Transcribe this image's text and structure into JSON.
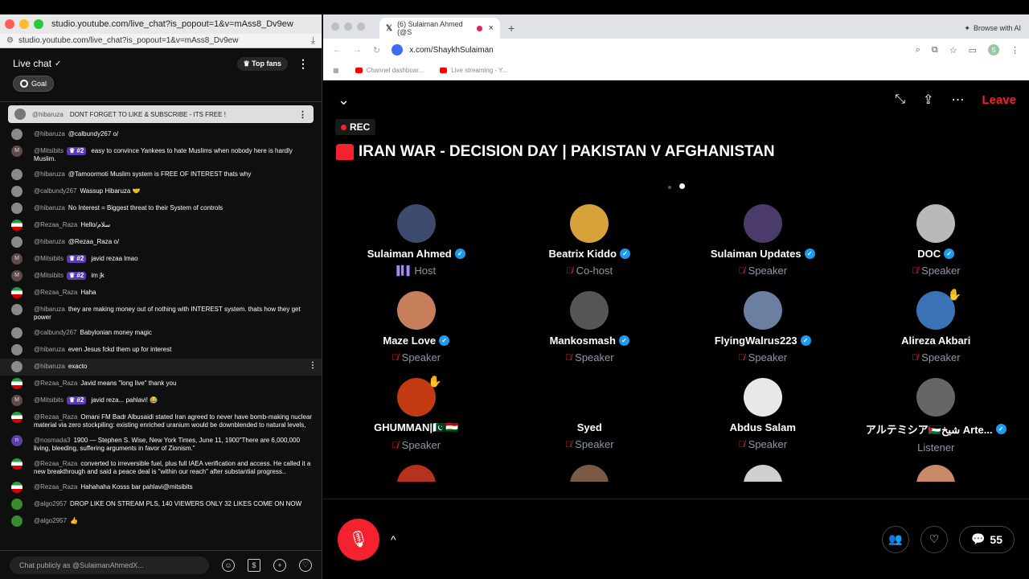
{
  "left_window": {
    "title": "studio.youtube.com/live_chat?is_popout=1&v=mAss8_Dv9ew",
    "url": "studio.youtube.com/live_chat?is_popout=1&v=mAss8_Dv9ew",
    "chat_title": "Live chat",
    "top_fans_label": "Top fans",
    "goal_label": "Goal",
    "pinned": {
      "author": "@hibaruza",
      "text": "DONT FORGET TO LIKE & SUBSCRIBE - ITS FREE !"
    },
    "messages": [
      {
        "author": "@hibaruza",
        "text": "@calbundy267 o/",
        "avatar": "gray",
        "initial": "",
        "badge": ""
      },
      {
        "author": "@Mitsibits",
        "text": "easy to convince Yankees to hate Muslims when nobody here is hardly Muslim.",
        "avatar": "m",
        "initial": "M",
        "badge": "#2"
      },
      {
        "author": "@hibaruza",
        "text": "@Tamoormoti Muslim system is FREE OF INTEREST thats why",
        "avatar": "gray",
        "initial": "",
        "badge": ""
      },
      {
        "author": "@calbundy267",
        "text": "Wassup Hibaruza 🤝",
        "avatar": "gray",
        "initial": "",
        "badge": ""
      },
      {
        "author": "@hibaruza",
        "text": "No Interest = Biggest threat to their System of controls",
        "avatar": "gray",
        "initial": "",
        "badge": ""
      },
      {
        "author": "@Rezaa_Raza",
        "text": "Hello/سلام",
        "avatar": "flag",
        "initial": "",
        "badge": ""
      },
      {
        "author": "@hibaruza",
        "text": "@Rezaa_Raza o/",
        "avatar": "gray",
        "initial": "",
        "badge": ""
      },
      {
        "author": "@Mitsibits",
        "text": "javid rezaa lmao",
        "avatar": "m",
        "initial": "M",
        "badge": "#2"
      },
      {
        "author": "@Mitsibits",
        "text": "im jk",
        "avatar": "m",
        "initial": "M",
        "badge": "#2"
      },
      {
        "author": "@Rezaa_Raza",
        "text": "Haha",
        "avatar": "flag",
        "initial": "",
        "badge": ""
      },
      {
        "author": "@hibaruza",
        "text": "they are making money out of nothing with INTEREST system. thats how they get power",
        "avatar": "gray",
        "initial": "",
        "badge": ""
      },
      {
        "author": "@calbundy267",
        "text": "Babylonian money magic",
        "avatar": "gray",
        "initial": "",
        "badge": ""
      },
      {
        "author": "@hibaruza",
        "text": "even Jesus fckd them up for interest",
        "avatar": "gray",
        "initial": "",
        "badge": ""
      },
      {
        "author": "@hibaruza",
        "text": "exacto",
        "avatar": "gray",
        "initial": "",
        "badge": "",
        "highlight": true
      },
      {
        "author": "@Rezaa_Raza",
        "text": "Javid means \"long live\" thank you",
        "avatar": "flag",
        "initial": "",
        "badge": ""
      },
      {
        "author": "@Mitsibits",
        "text": "javid reza... pahlavi! 😂",
        "avatar": "m",
        "initial": "M",
        "badge": "#2"
      },
      {
        "author": "@Rezaa_Raza",
        "text": "Omani FM Badr Albusaidi stated Iran agreed to never have bomb-making nuclear material via zero stockpiling: existing enriched uranium would be downblended to natural levels,",
        "avatar": "flag",
        "initial": "",
        "badge": ""
      },
      {
        "author": "@nosmada3",
        "text": "1900 — Stephen S. Wise, New York Times, June 11, 1900\"There are 6,000,000 living, bleeding, suffering arguments in favor of Zionism.\"",
        "avatar": "n",
        "initial": "n",
        "badge": ""
      },
      {
        "author": "@Rezaa_Raza",
        "text": "converted to irreversible fuel, plus full IAEA verification and access. He called it a new breakthrough and said a peace deal is \"within our reach\" after substantial progress..",
        "avatar": "flag",
        "initial": "",
        "badge": ""
      },
      {
        "author": "@Rezaa_Raza",
        "text": "Hahahaha Kosss bar pahlavi@mitsibits",
        "avatar": "flag",
        "initial": "",
        "badge": ""
      },
      {
        "author": "@algo2957",
        "text": "DROP LIKE ON STREAM PLS, 140 VIEWERS ONLY 32 LIKES COME ON NOW",
        "avatar": "frog",
        "initial": "",
        "badge": ""
      },
      {
        "author": "@algo2957",
        "text": "👍",
        "avatar": "frog",
        "initial": "",
        "badge": ""
      }
    ],
    "input_placeholder": "Chat publicly as @SulaimanAhmedX..."
  },
  "right_window": {
    "tab_title": "(6) Sulaiman Ahmed (@S",
    "browse_ai_label": "Browse with AI",
    "url": "x.com/ShaykhSulaiman",
    "bookmarks": [
      "Channel dashboar...",
      "Live streaming - Y..."
    ],
    "space": {
      "leave_label": "Leave",
      "rec_label": "REC",
      "title": "IRAN WAR - DECISION DAY | PAKISTAN V AFGHANISTAN",
      "participants": [
        {
          "name": "Sulaiman Ahmed",
          "role": "Host",
          "verified": true,
          "color": "#3c4b6e",
          "mic": "host"
        },
        {
          "name": "Beatrix Kiddo",
          "role": "Co-host",
          "verified": true,
          "color": "#d8a23a",
          "mic": "off"
        },
        {
          "name": "Sulaiman Updates",
          "role": "Speaker",
          "verified": true,
          "color": "#4a3b6a",
          "mic": "off"
        },
        {
          "name": "DOC",
          "role": "Speaker",
          "verified": true,
          "color": "#b9b9b9",
          "mic": "off"
        },
        {
          "name": "Maze Love",
          "role": "Speaker",
          "verified": true,
          "color": "#c77f5b",
          "mic": "off"
        },
        {
          "name": "Mankosmash",
          "role": "Speaker",
          "verified": true,
          "color": "#555555",
          "mic": "off"
        },
        {
          "name": "FlyingWalrus223",
          "role": "Speaker",
          "verified": true,
          "color": "#6d7fa0",
          "mic": "off"
        },
        {
          "name": "Alireza Akbari",
          "role": "Speaker",
          "verified": false,
          "color": "#3a73b5",
          "mic": "off",
          "hand": true
        },
        {
          "name": "GHUMMAN|🇵🇰🇹🇯",
          "role": "Speaker",
          "verified": false,
          "color": "#c23a12",
          "mic": "off",
          "hand": true
        },
        {
          "name": "Syed",
          "role": "Speaker",
          "verified": false,
          "color": "#000000",
          "mic": "off"
        },
        {
          "name": "Abdus Salam",
          "role": "Speaker",
          "verified": false,
          "color": "#e8e8e8",
          "mic": "off"
        },
        {
          "name": "アルテミシア🇵🇸شيخ Arte...",
          "role": "Listener",
          "verified": true,
          "color": "#666666",
          "mic": "none"
        },
        {
          "name": "",
          "role": "",
          "verified": false,
          "color": "#b5321c",
          "mic": "none"
        },
        {
          "name": "",
          "role": "",
          "verified": false,
          "color": "#7a5a45",
          "mic": "none"
        },
        {
          "name": "",
          "role": "",
          "verified": false,
          "color": "#cfcfcf",
          "mic": "none"
        },
        {
          "name": "",
          "role": "",
          "verified": false,
          "color": "#c98a6a",
          "mic": "none"
        }
      ],
      "comments_count": "55"
    }
  }
}
